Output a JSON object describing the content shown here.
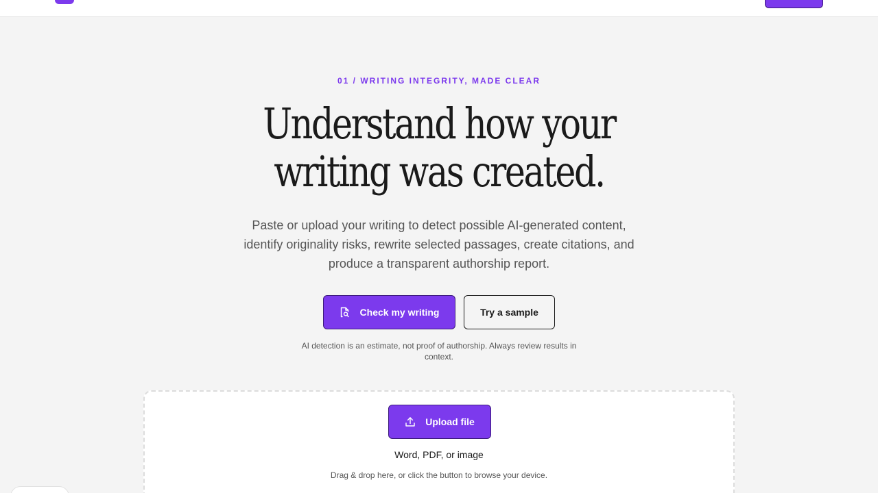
{
  "header": {
    "logo_icon": "brand-logo-mark",
    "cta_icon": "nav-cta-button"
  },
  "hero": {
    "eyebrow": "01 / WRITING INTEGRITY, MADE CLEAR",
    "title_line1": "Understand how your",
    "title_line2": "writing was created.",
    "subtitle": "Paste or upload your writing to detect possible AI-generated content, identify originality risks, rewrite selected passages, create citations, and produce a transparent authorship report.",
    "primary_button": {
      "label": "Check my writing",
      "icon": "document-search-icon"
    },
    "secondary_button": {
      "label": "Try a sample"
    },
    "disclaimer": "AI detection is an estimate, not proof of authorship. Always review results in context."
  },
  "upload": {
    "button_label": "Upload file",
    "button_icon": "upload-icon",
    "types": "Word, PDF, or image",
    "hint": "Drag & drop here, or click the button to browse your device."
  },
  "colors": {
    "accent": "#7c3aed",
    "background": "#f4f4f4",
    "text": "#1a1a1a",
    "muted": "#555555"
  }
}
